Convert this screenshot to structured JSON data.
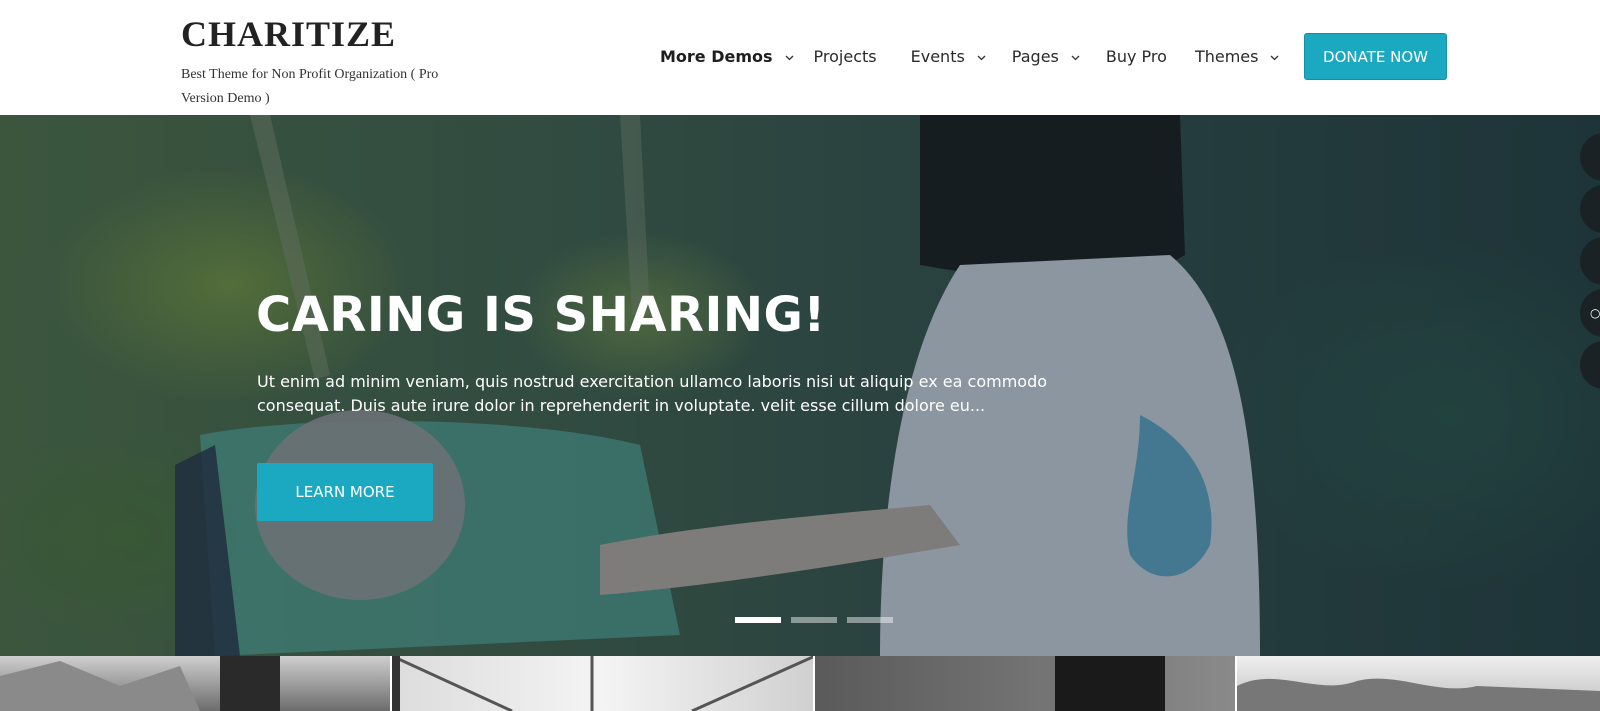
{
  "header": {
    "site_title": "CHARITIZE",
    "tagline": "Best Theme for Non Profit Organization ( Pro Version Demo )",
    "nav": [
      {
        "label": "More Demos",
        "has_dropdown": true,
        "active": true
      },
      {
        "label": "Projects",
        "has_dropdown": false,
        "active": false
      },
      {
        "label": "Events",
        "has_dropdown": true,
        "active": false
      },
      {
        "label": "Pages",
        "has_dropdown": true,
        "active": false
      },
      {
        "label": "Buy Pro",
        "has_dropdown": false,
        "active": false
      },
      {
        "label": "Themes",
        "has_dropdown": true,
        "active": false
      }
    ],
    "donate_label": "DONATE NOW"
  },
  "hero": {
    "title": "CARING IS SHARING!",
    "text": "Ut enim ad minim veniam, quis nostrud exercitation ullamco laboris nisi ut aliquip ex ea commodo consequat. Duis aute irure dolor in reprehenderit in voluptate. velit esse cillum dolore eu...",
    "button_label": "LEARN MORE",
    "slides": 3,
    "active_slide": 1
  },
  "social": {
    "icons": [
      "social-icon-1",
      "social-icon-2",
      "social-icon-3",
      "social-icon-4",
      "social-icon-5"
    ]
  },
  "colors": {
    "accent": "#1ba9c2",
    "title_text": "#222222",
    "nav_text": "#2a2a2a"
  }
}
